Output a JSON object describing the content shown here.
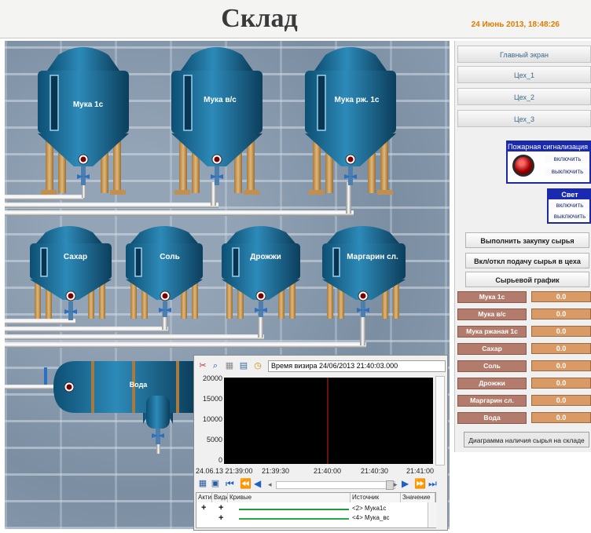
{
  "header": {
    "title": "Склад",
    "datetime": "24 Июнь 2013, 18:48:26"
  },
  "tanks": [
    {
      "label": "Мука 1с"
    },
    {
      "label": "Мука в/с"
    },
    {
      "label": "Мука рж. 1с"
    },
    {
      "label": "Сахар"
    },
    {
      "label": "Соль"
    },
    {
      "label": "Дрожжи"
    },
    {
      "label": "Маргарин сл."
    },
    {
      "label": "Вода"
    }
  ],
  "nav": {
    "main": "Главный экран",
    "shop1": "Цех_1",
    "shop2": "Цех_2",
    "shop3": "Цех_3"
  },
  "fire_alarm": {
    "title": "Пожарная сигнализация",
    "on": "включить",
    "off": "выключить"
  },
  "light": {
    "title": "Свет",
    "on": "включить",
    "off": "выключить"
  },
  "actions": {
    "purchase": "Выполнить закупку сырья",
    "feed_toggle": "Вкл/откл подачу сырья в цеха",
    "raw_chart": "Сырьевой график"
  },
  "materials": [
    {
      "name": "Мука 1с",
      "value": "0.0"
    },
    {
      "name": "Мука в/с",
      "value": "0.0"
    },
    {
      "name": "Мука ржаная 1с",
      "value": "0.0"
    },
    {
      "name": "Сахар",
      "value": "0.0"
    },
    {
      "name": "Соль",
      "value": "0.0"
    },
    {
      "name": "Дрожжи",
      "value": "0.0"
    },
    {
      "name": "Маргарин сл.",
      "value": "0.0"
    },
    {
      "name": "Вода",
      "value": "0.0"
    }
  ],
  "diagram_button": "Диаграмма наличия сырья на складе",
  "trend": {
    "visir": "Время визира 24/06/2013 21:40:03.000",
    "y_ticks": [
      "20000",
      "15000",
      "10000",
      "5000",
      "0"
    ],
    "x_ticks": [
      "24.06.13 21:39:00",
      "21:39:30",
      "21:40:00",
      "21:40:30",
      "21:41:00"
    ],
    "columns": [
      "Активн",
      "Видим",
      "Кривые",
      "Источник",
      "Значение"
    ],
    "rows": [
      {
        "active": "+",
        "visible": "+",
        "source": "<2> Мука1с",
        "color": "#1e9a3a"
      },
      {
        "active": "",
        "visible": "+",
        "source": "<4> Мука_вс",
        "color": "#2aa84a"
      }
    ]
  }
}
